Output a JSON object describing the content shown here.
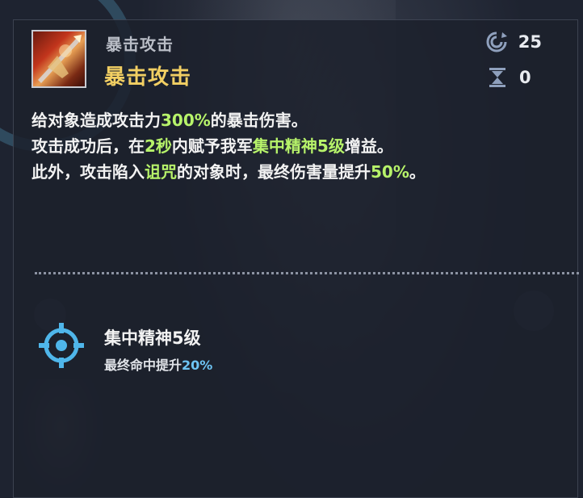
{
  "skill": {
    "icon": "crossbow-skill-icon",
    "subtitle": "暴击攻击",
    "title": "暴击攻击",
    "cooldown": "25",
    "turns": "0",
    "description": [
      [
        {
          "text": "给对象造成攻击力",
          "style": "normal"
        },
        {
          "text": "300%",
          "style": "green"
        },
        {
          "text": "的暴击伤害。",
          "style": "normal"
        }
      ],
      [
        {
          "text": "攻击成功后，在",
          "style": "normal"
        },
        {
          "text": "2秒",
          "style": "green"
        },
        {
          "text": "内赋予我军",
          "style": "normal"
        },
        {
          "text": "集中精神5级",
          "style": "green"
        },
        {
          "text": "增益。",
          "style": "normal"
        }
      ],
      [
        {
          "text": "此外，攻击陷入",
          "style": "normal"
        },
        {
          "text": "诅咒",
          "style": "green"
        },
        {
          "text": "的对象时，最终伤害量提升",
          "style": "normal"
        },
        {
          "text": "50%",
          "style": "green"
        },
        {
          "text": "。",
          "style": "normal"
        }
      ]
    ]
  },
  "buff": {
    "icon": "crosshair-icon",
    "name": "集中精神5级",
    "desc_prefix": "最终命中提升",
    "desc_value": "20%"
  },
  "colors": {
    "highlight_green": "#b7f36a",
    "title_gold": "#f2cf63",
    "value_blue": "#6ec4f4"
  }
}
